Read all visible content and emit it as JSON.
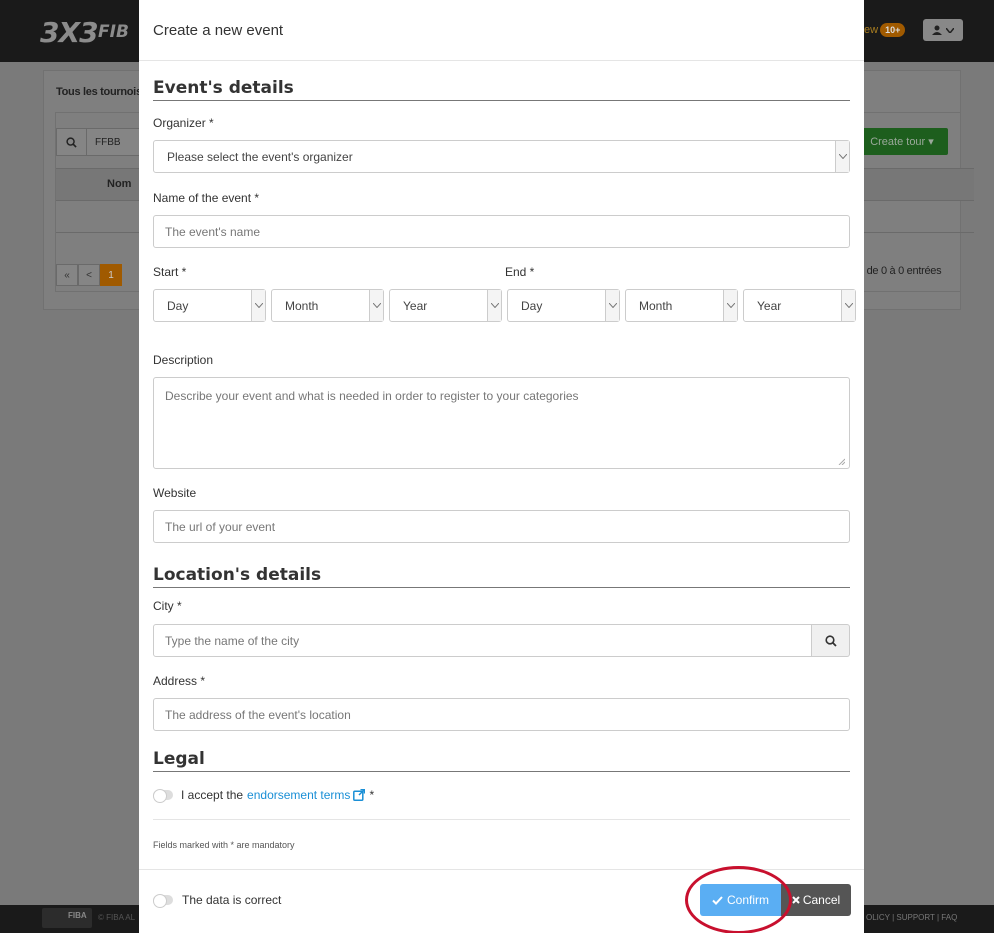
{
  "background": {
    "logo": "3X3",
    "logo_suffix": "FIB",
    "new_label": "ew",
    "new_badge": "10+",
    "panel_title": "Tous les tournois",
    "search_value": "FFBB",
    "create_tour_label": "Create tour",
    "table_header_name": "Nom",
    "pager": [
      "«",
      "<",
      "1"
    ],
    "entries_text": "0 de 0 à 0 entrées",
    "footer_logo": "FIBA",
    "footer_left": "© FIBA AL",
    "footer_links": "OLICY | SUPPORT | FAQ"
  },
  "modal": {
    "title": "Create a new event",
    "event_section": "Event's details",
    "organizer_label": "Organizer *",
    "organizer_placeholder": "Please select the event's organizer",
    "name_label": "Name of the event *",
    "name_placeholder": "The event's name",
    "start_label": "Start *",
    "end_label": "End *",
    "date_selects": [
      "Day",
      "Month",
      "Year",
      "Day",
      "Month",
      "Year"
    ],
    "description_label": "Description",
    "description_placeholder": "Describe your event and what is needed in order to register to your categories",
    "website_label": "Website",
    "website_placeholder": "The url of your event",
    "location_section": "Location's details",
    "city_label": "City *",
    "city_placeholder": "Type the name of the city",
    "address_label": "Address *",
    "address_placeholder": "The address of the event's location",
    "legal_section": "Legal",
    "accept_prefix": "I accept the",
    "endorsement_link": "endorsement terms",
    "accept_suffix": "*",
    "mandatory_note": "Fields marked with * are mandatory",
    "data_correct_label": "The data is correct",
    "confirm_label": "Confirm",
    "cancel_label": "Cancel"
  },
  "colors": {
    "confirm": "#5aaef3",
    "cancel": "#555555",
    "link": "#1a8fd6",
    "highlight": "#c8102e"
  }
}
